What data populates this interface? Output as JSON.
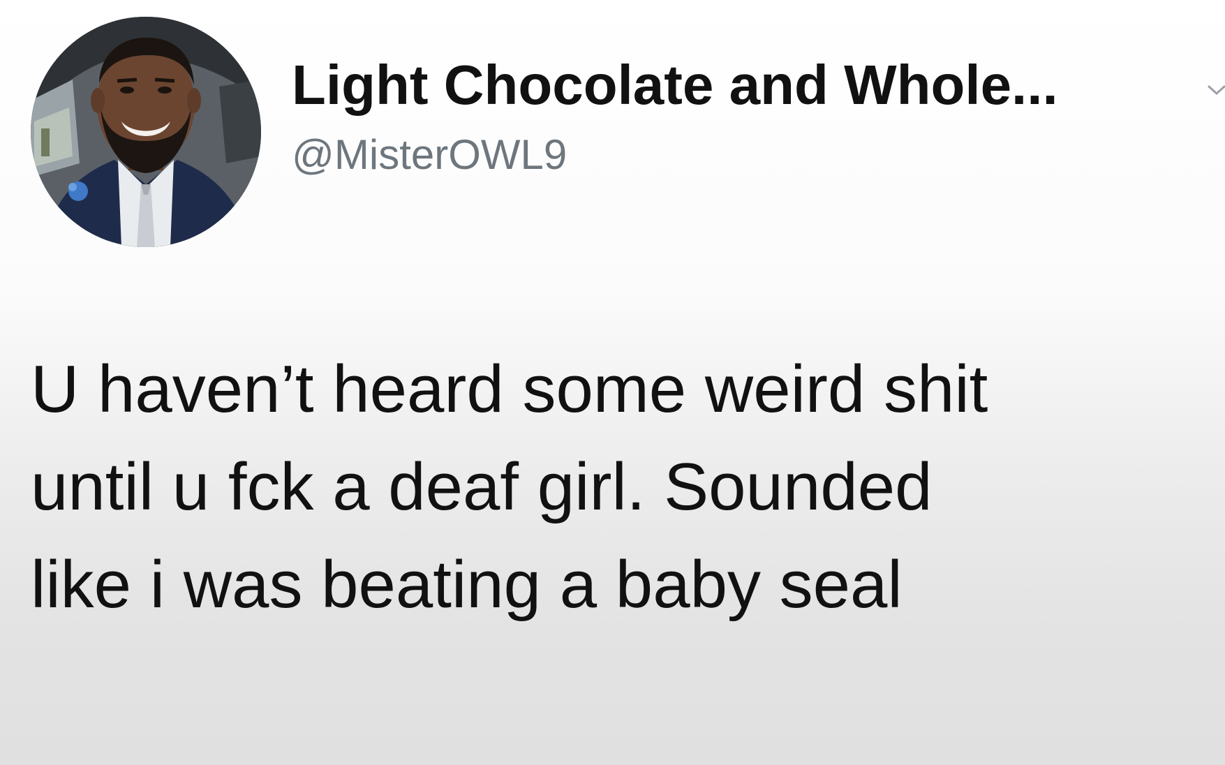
{
  "tweet": {
    "author": {
      "display_name": "Light Chocolate and Whole...",
      "handle": "@MisterOWL9",
      "avatar_icon": "profile-photo"
    },
    "menu_icon": "chevron-down-icon",
    "text_lines": [
      "U haven’t heard some weird shit",
      "until u fck a deaf girl. Sounded",
      "like i was beating a baby seal"
    ]
  },
  "colors": {
    "text": "#111111",
    "handle": "#6e767d",
    "background_top": "#ffffff",
    "background_bottom": "#e0e0e0"
  }
}
